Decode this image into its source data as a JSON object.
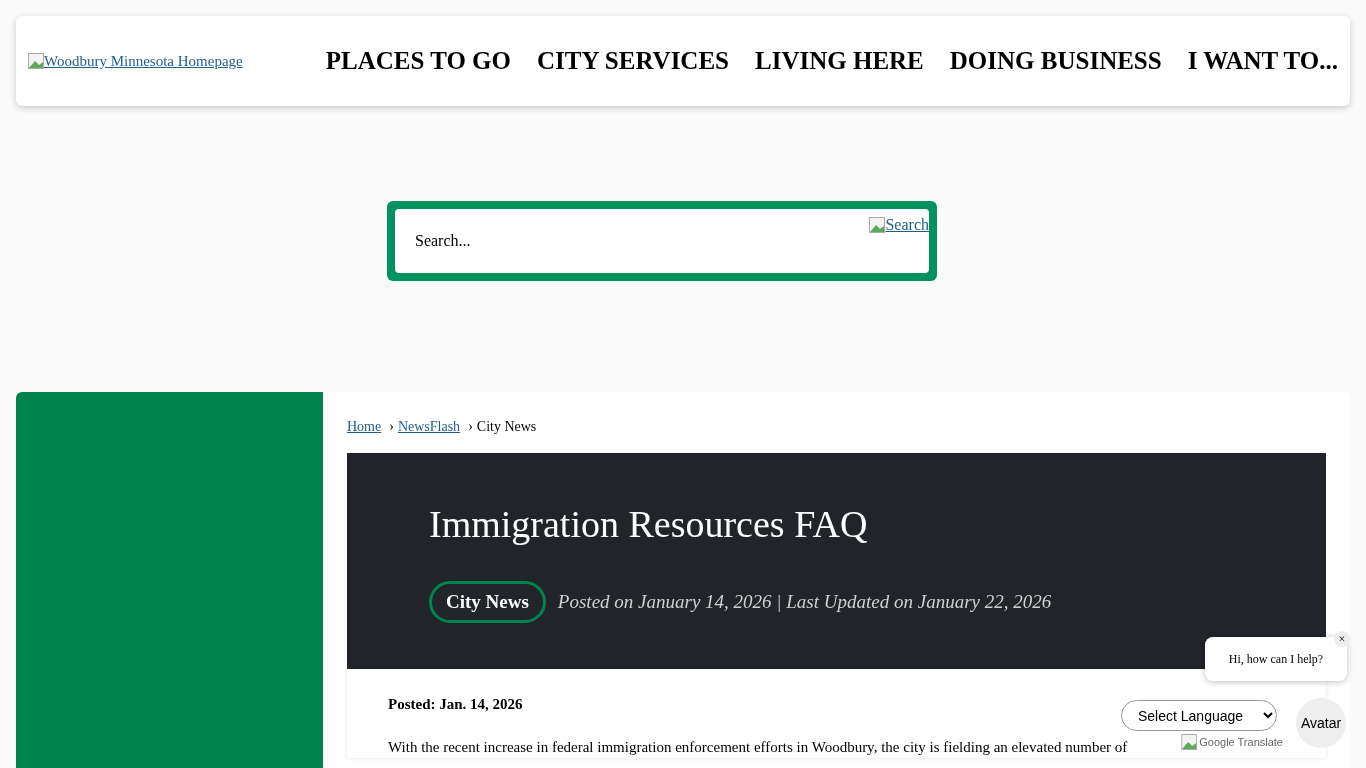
{
  "header": {
    "logo_alt": "Woodbury Minnesota Homepage",
    "nav": [
      "PLACES TO GO",
      "CITY SERVICES",
      "LIVING HERE",
      "DOING BUSINESS",
      "I WANT TO..."
    ]
  },
  "search": {
    "placeholder": "Search...",
    "button_alt": "Search"
  },
  "breadcrumb": [
    {
      "label": "Home",
      "link": true
    },
    {
      "separator": "›",
      "label": "NewsFlash",
      "link": true
    },
    {
      "separator": "›",
      "label": "City News",
      "link": false
    }
  ],
  "article": {
    "title": "Immigration Resources FAQ",
    "category": "City News",
    "meta": "Posted on January 14, 2026 | Last Updated on January 22, 2026",
    "posted": "Posted: Jan. 14, 2026",
    "body": "With the recent increase in federal immigration enforcement efforts in Woodbury, the city is fielding an elevated number of"
  },
  "translate": {
    "select": "Select Language",
    "powered": "Google Translate"
  },
  "chat": {
    "greeting": "Hi, how can I help?",
    "close": "×",
    "avatar": "Avatar"
  }
}
